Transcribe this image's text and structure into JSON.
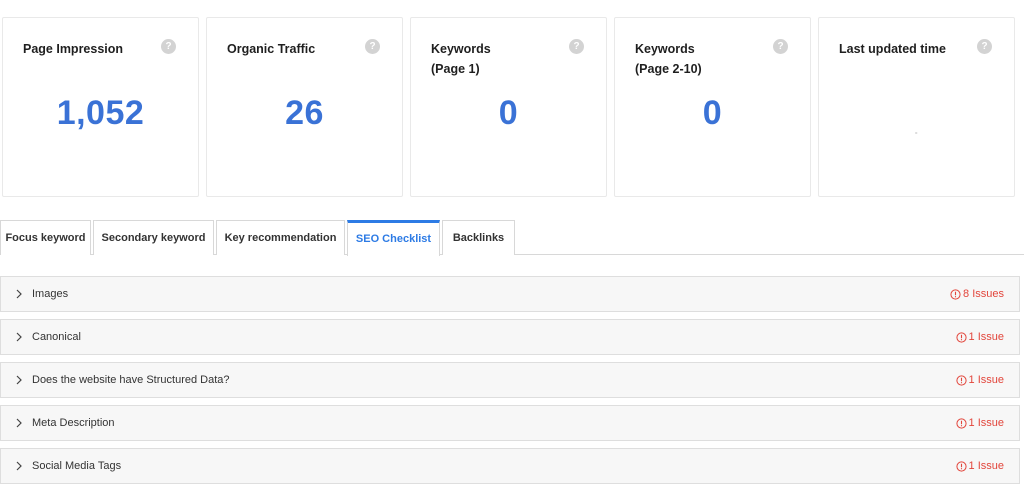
{
  "cards": [
    {
      "title": "Page Impression",
      "value": "1,052"
    },
    {
      "title": "Organic Traffic",
      "value": "26"
    },
    {
      "title": "Keywords\n(Page 1)",
      "value": "0"
    },
    {
      "title": "Keywords\n(Page 2-10)",
      "value": "0"
    },
    {
      "title": "Last updated time",
      "value": "-"
    }
  ],
  "help_glyph": "?",
  "tabs": [
    {
      "label": "Focus keyword"
    },
    {
      "label": "Secondary keyword"
    },
    {
      "label": "Key recommendation"
    },
    {
      "label": "SEO Checklist",
      "active": true
    },
    {
      "label": "Backlinks"
    }
  ],
  "checklist": [
    {
      "label": "Images",
      "issues": "8 Issues"
    },
    {
      "label": "Canonical",
      "issues": "1 Issue"
    },
    {
      "label": "Does the website have Structured Data?",
      "issues": "1 Issue"
    },
    {
      "label": "Meta Description",
      "issues": "1 Issue"
    },
    {
      "label": "Social Media Tags",
      "issues": "1 Issue"
    }
  ],
  "colors": {
    "accent": "#2d7be5",
    "value_blue": "#3a72d6",
    "issue_red": "#e2453b"
  }
}
